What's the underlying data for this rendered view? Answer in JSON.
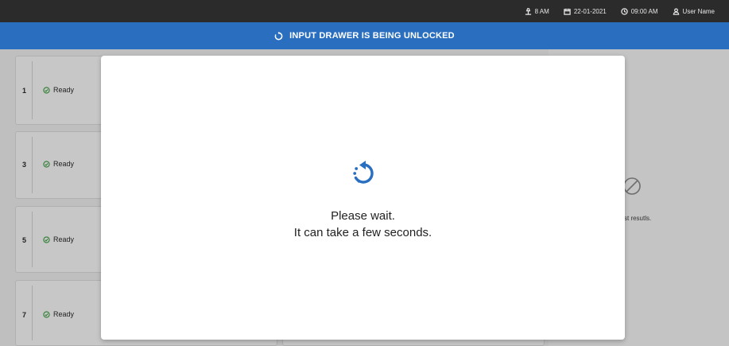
{
  "topbar": {
    "status_value": "8 AM",
    "date": "22-01-2021",
    "time": "09:00 AM",
    "user": "User Name"
  },
  "banner": {
    "text": "INPUT DRAWER IS BEING UNLOCKED"
  },
  "cards": [
    {
      "number": "1",
      "status": "Ready"
    },
    {
      "number": "3",
      "status": "Ready"
    },
    {
      "number": "5",
      "status": "Ready"
    },
    {
      "number": "7",
      "status": "Ready"
    }
  ],
  "right_panel": {
    "text": "st resutls."
  },
  "modal": {
    "line1": "Please wait.",
    "line2": "It can take a few seconds."
  },
  "colors": {
    "accent": "#2a6fbf",
    "topbar": "#2b2b2b",
    "ready_icon": "#2e7d32"
  }
}
